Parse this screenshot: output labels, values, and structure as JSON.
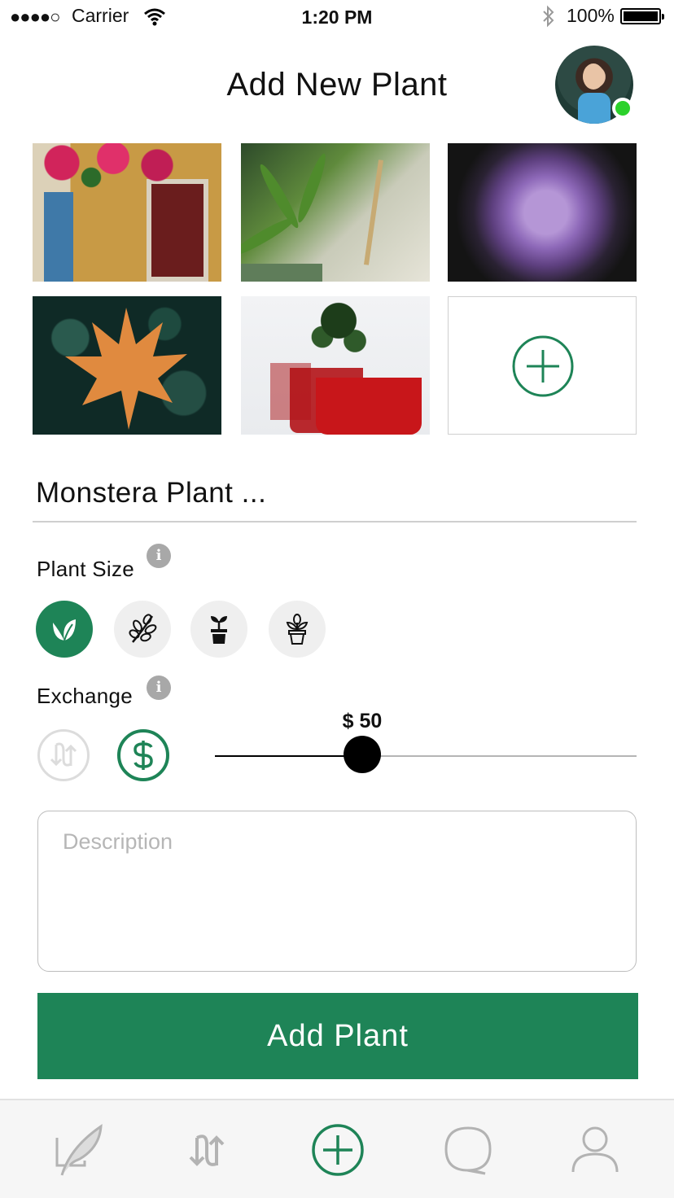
{
  "status_bar": {
    "signal": "●●●●○",
    "carrier": "Carrier",
    "time": "1:20 PM",
    "battery": "100%"
  },
  "header": {
    "title": "Add New Plant"
  },
  "form": {
    "plant_name": "Monstera Plant ...",
    "plant_size_label": "Plant Size",
    "exchange_label": "Exchange",
    "info_glyph": "i",
    "price_label": "$ 50",
    "price_value": 50,
    "price_slider_level": 0.35,
    "description_placeholder": "Description",
    "submit_label": "Add Plant"
  },
  "colors": {
    "accent": "#1e8457",
    "online": "#2bd12b"
  },
  "icons": {
    "size_options": [
      "leaf-icon",
      "branch-icon",
      "seedling-pot-icon",
      "flower-pot-icon"
    ],
    "exchange_options": [
      "trade-icon",
      "dollar-icon"
    ],
    "tabs": [
      "feather-edit-icon",
      "trade-icon",
      "add-circle-icon",
      "chat-bubble-icon",
      "profile-icon"
    ]
  }
}
